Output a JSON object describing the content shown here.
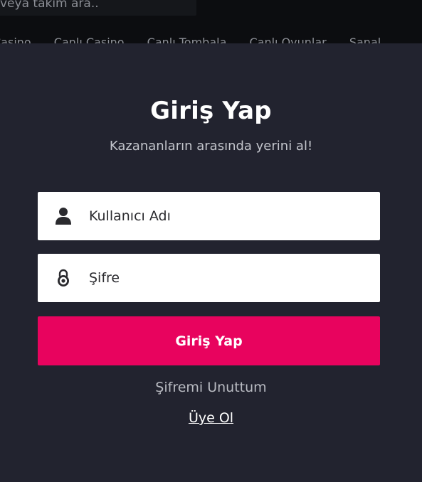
{
  "background": {
    "search_text": "veya takım ara..",
    "nav_items": [
      "Casino",
      "Canlı Casino",
      "Canlı Tombala",
      "Canlı Oyunlar",
      "Sanal"
    ]
  },
  "login": {
    "title": "Giriş Yap",
    "subtitle": "Kazananların arasında yerini al!",
    "username_placeholder": "Kullanıcı Adı",
    "password_placeholder": "Şifre",
    "submit_label": "Giriş Yap",
    "forgot_label": "Şifremi Unuttum",
    "register_label": "Üye Ol"
  },
  "icons": {
    "username": "user-icon",
    "password": "lock-icon"
  },
  "colors": {
    "modal_bg": "#22232f",
    "primary_button": "#e8035e",
    "field_bg": "#ffffff"
  }
}
